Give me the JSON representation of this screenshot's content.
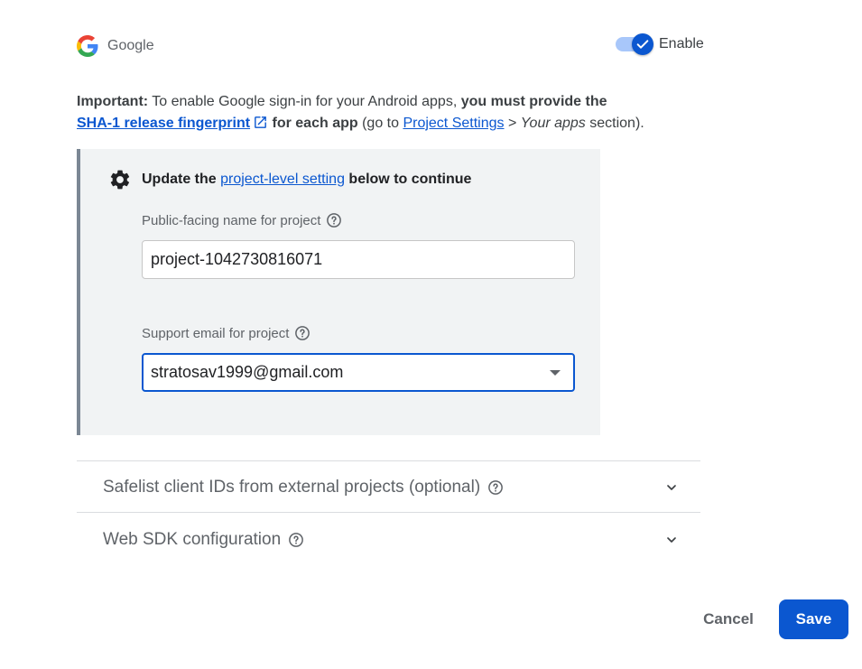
{
  "provider": {
    "name": "Google",
    "icon": "google-logo-icon"
  },
  "enable_toggle": {
    "label": "Enable",
    "checked": true
  },
  "important": {
    "lead": "Important:",
    "t1": " To enable Google sign-in for your Android apps, ",
    "b1": "you must provide the",
    "link": "SHA-1 release fingerprint",
    "b2": " for each app",
    "t2": " (go to ",
    "link2": "Project Settings",
    "t3": " > ",
    "i1": "Your apps",
    "t4": " section)."
  },
  "setting_box": {
    "icon": "gear-icon",
    "prefix": "Update the ",
    "link": "project-level setting",
    "suffix": " below to continue",
    "public_name": {
      "label": "Public-facing name for project",
      "value": "project-1042730816071"
    },
    "support_email": {
      "label": "Support email for project",
      "value": "stratosav1999@gmail.com"
    }
  },
  "accordions": [
    {
      "title": "Safelist client IDs from external projects (optional)"
    },
    {
      "title": "Web SDK configuration"
    }
  ],
  "actions": {
    "cancel": "Cancel",
    "save": "Save"
  },
  "colors": {
    "accent": "#0b57d0",
    "toggle_track": "#a8c7fa",
    "panel_bg": "#f1f3f4"
  }
}
